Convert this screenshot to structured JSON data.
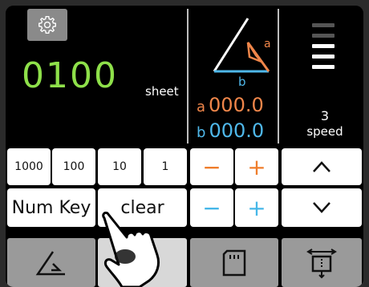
{
  "display": {
    "counter_value": "0100",
    "counter_unit": "sheet",
    "angle_side_a_letter": "a",
    "angle_side_b_letter": "b",
    "value_a_label": "a",
    "value_a": "000.0",
    "value_b_label": "b",
    "value_b": "000.0",
    "speed_value": "3",
    "speed_label": "speed",
    "speed_level": 3,
    "speed_max": 5
  },
  "keypad": {
    "key_1000": "1000",
    "key_100": "100",
    "key_10": "10",
    "key_1": "1",
    "num_key_label": "Num Key",
    "clear_label": "clear",
    "a_minus": "−",
    "a_plus": "+",
    "b_minus": "−",
    "b_plus": "+"
  },
  "icons": {
    "settings": "gear-icon",
    "up": "chevron-up-icon",
    "down": "chevron-down-icon",
    "tab_angle": "angle-icon",
    "tab_clamp": "clamp-icon",
    "tab_card": "sd-card-icon",
    "tab_width": "width-adjust-icon"
  },
  "colors": {
    "counter": "#8ee04a",
    "value_a": "#f0864a",
    "value_b": "#4fb8ea",
    "minus_plus_a": "#ef7d2b",
    "minus_plus_b": "#45b7e8",
    "tab_bg": "#9a9a9a",
    "tab_active_bg": "#d8d8d8"
  }
}
